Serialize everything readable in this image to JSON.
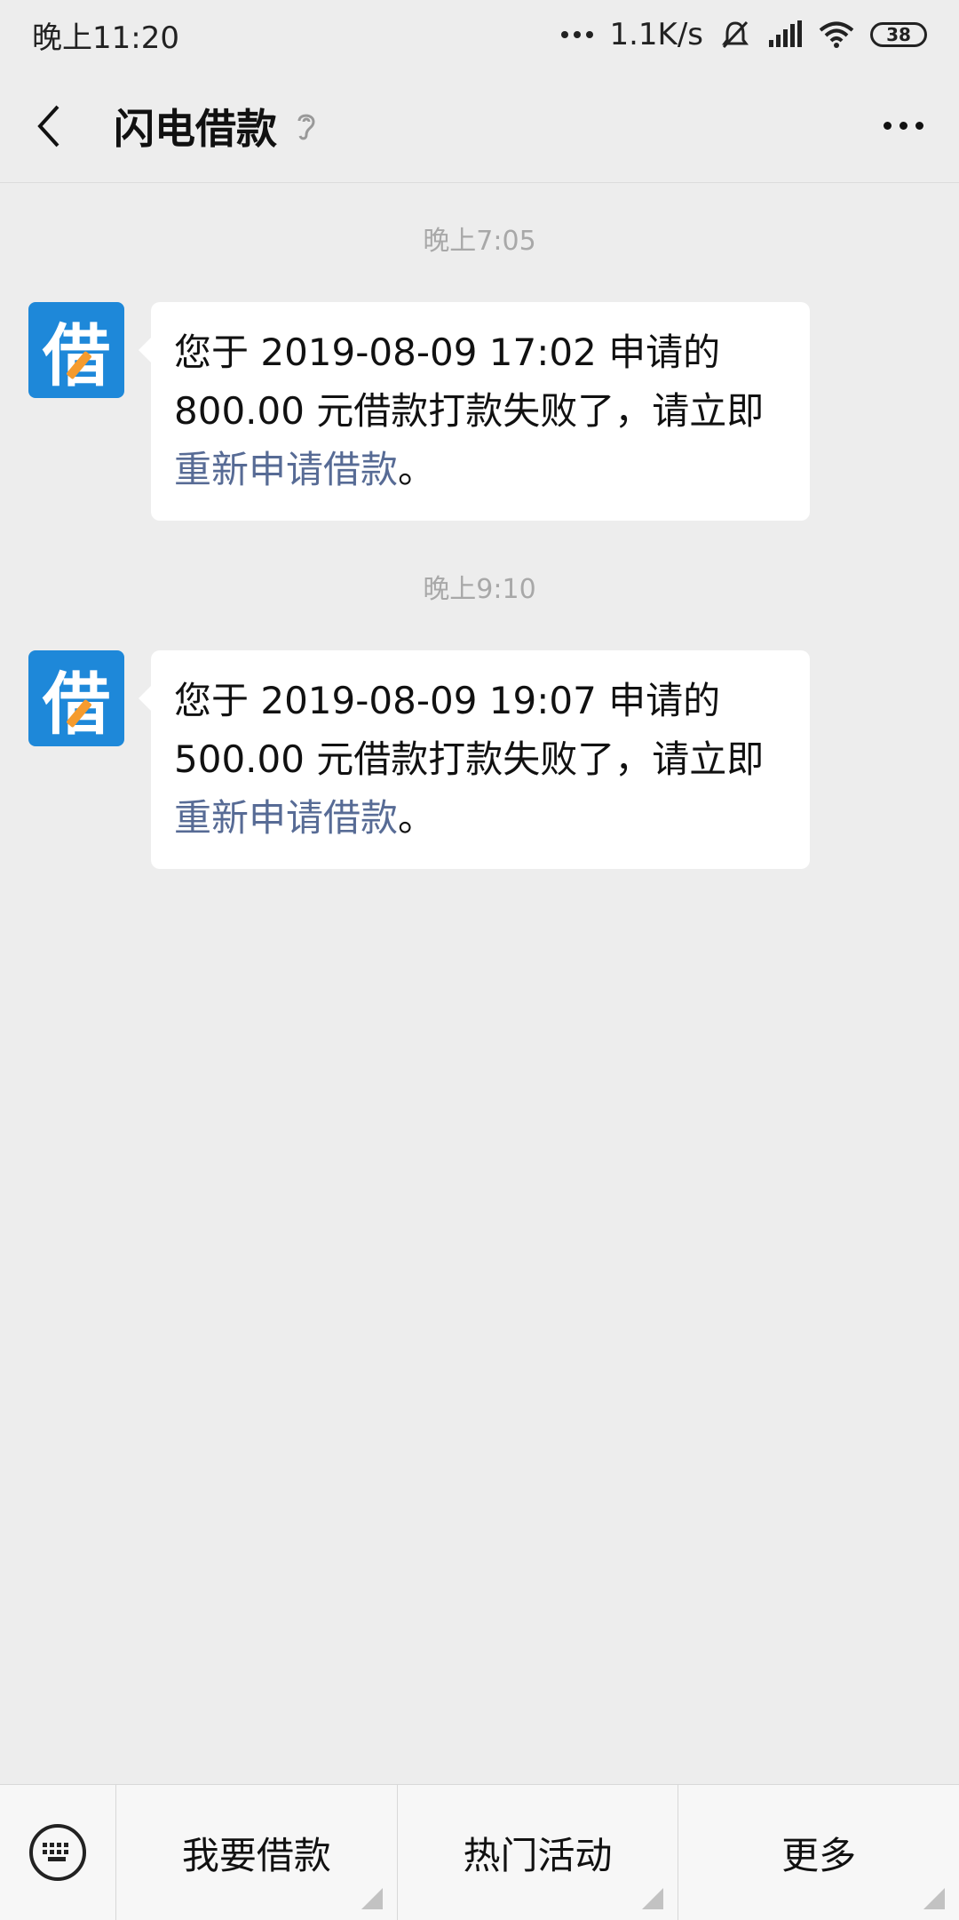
{
  "status": {
    "time": "晚上11:20",
    "net_speed": "1.1K/s",
    "battery": "38"
  },
  "header": {
    "title": "闪电借款"
  },
  "messages": [
    {
      "time": "晚上7:05",
      "avatar_char": "借",
      "text": "您于 2019-08-09 17:02 申请的 800.00 元借款打款失败了，请立即",
      "link": "重新申请借款",
      "tail": "。"
    },
    {
      "time": "晚上9:10",
      "avatar_char": "借",
      "text": "您于 2019-08-09 19:07 申请的 500.00 元借款打款失败了，请立即",
      "link": "重新申请借款",
      "tail": "。"
    }
  ],
  "menu": {
    "items": [
      "我要借款",
      "热门活动",
      "更多"
    ]
  },
  "colors": {
    "link": "#576b95",
    "avatar_bg": "#1e88d9",
    "background": "#ededed"
  }
}
